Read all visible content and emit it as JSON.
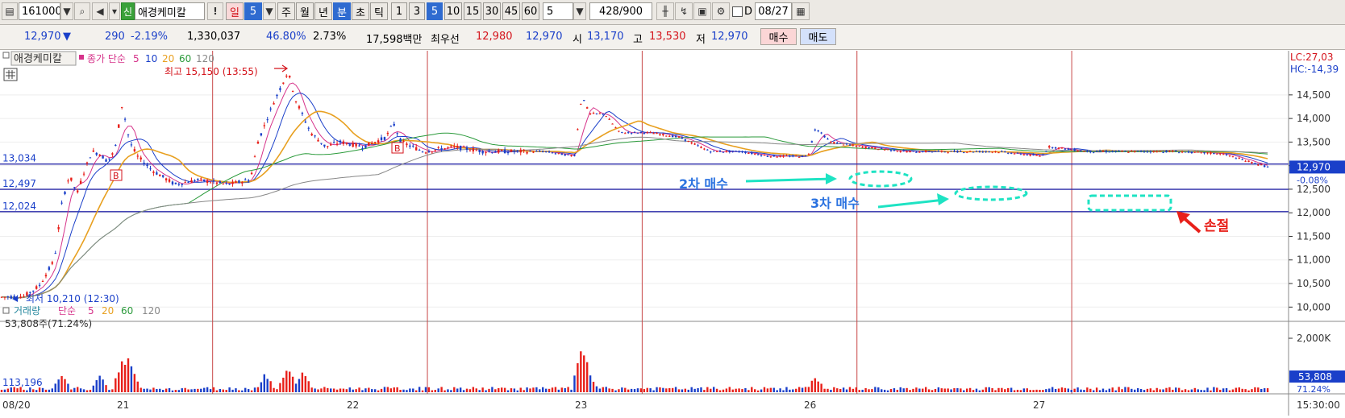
{
  "toolbar": {
    "code": "161000",
    "badge": "신",
    "stock_name": "애경케미칼",
    "exclaim": "!",
    "period_day": "일",
    "period_num": "5",
    "week": "주",
    "month": "월",
    "year": "년",
    "minute": "분",
    "second": "초",
    "tick": "틱",
    "intervals": [
      "1",
      "3",
      "5",
      "10",
      "15",
      "30",
      "45",
      "60"
    ],
    "selected_interval": "5",
    "count_value": "5",
    "bars_shown": "428",
    "bars_total": "/900",
    "date_check_label": "D",
    "date_value": "08/27"
  },
  "quote": {
    "price": "12,970",
    "change_arrow": "▼",
    "change": "290",
    "change_pct": "-2.19%",
    "volume": "1,330,037",
    "vol_ratio": "46.80%",
    "turnover": "2.73%",
    "amount": "17,598백만",
    "best_label": "최우선",
    "best_ask": "12,980",
    "best_bid": "12,970",
    "open_label": "시",
    "open": "13,170",
    "high_label": "고",
    "high": "13,530",
    "low_label": "저",
    "low": "12,970",
    "buy_button": "매수",
    "sell_button": "매도"
  },
  "price_panel": {
    "title": "애경케미칼",
    "ma_label": "종가 단순",
    "ma_periods": [
      "5",
      "10",
      "20",
      "60",
      "120"
    ],
    "ma_colors": [
      "#d6338a",
      "#1a3fc9",
      "#e8a020",
      "#2a9a3a",
      "#888888"
    ],
    "max_label": "최고 15,150 (13:55)",
    "min_label": "최저 10,210 (12:30)",
    "lc_label": "LC:27,03",
    "hc_label": "HC:-14,39",
    "y_ticks": [
      "14,500",
      "14,000",
      "13,500",
      "13,000",
      "12,500",
      "12,000",
      "11,500",
      "11,000",
      "10,500",
      "10,000"
    ],
    "current_price_tag": "12,970",
    "current_pct_tag": "-0.08%",
    "hlines": [
      "13,034",
      "12,497",
      "12,024"
    ],
    "annotation_2nd": "2차 매수",
    "annotation_3rd": "3차 매수",
    "annotation_stop": "손절"
  },
  "volume_panel": {
    "title": "거래량",
    "ma_label": "단순",
    "ma_periods": [
      "5",
      "20",
      "60",
      "120"
    ],
    "volume_info": "53,808주(71.24%)",
    "left_value": "113,196",
    "y_tick": "2,000K",
    "current_tag": "53,808",
    "current_pct": "71.24%"
  },
  "x_axis": {
    "labels": [
      "08/20",
      "21",
      "22",
      "23",
      "26",
      "27"
    ],
    "time_label": "15:30:00"
  },
  "chart_data": {
    "type": "candlestick",
    "unit": "KRW",
    "interval": "5min",
    "days": [
      "08/20",
      "08/21",
      "08/22",
      "08/23",
      "08/26",
      "08/27"
    ],
    "ylim": [
      9800,
      15300
    ],
    "price_path": [
      {
        "t": 0,
        "p": 10210
      },
      {
        "t": 3,
        "p": 10230
      },
      {
        "t": 5,
        "p": 10450
      },
      {
        "t": 7,
        "p": 11000
      },
      {
        "t": 8,
        "p": 12200
      },
      {
        "t": 9,
        "p": 12800
      },
      {
        "t": 10,
        "p": 12400
      },
      {
        "t": 11,
        "p": 12900
      },
      {
        "t": 12,
        "p": 13300
      },
      {
        "t": 13,
        "p": 13250
      },
      {
        "t": 14,
        "p": 13100
      },
      {
        "t": 15,
        "p": 13300
      },
      {
        "t": 16,
        "p": 14300
      },
      {
        "t": 17,
        "p": 13500
      },
      {
        "t": 18,
        "p": 13200
      },
      {
        "t": 20,
        "p": 12900
      },
      {
        "t": 23,
        "p": 12600
      },
      {
        "t": 26,
        "p": 12700
      },
      {
        "t": 30,
        "p": 12600
      },
      {
        "t": 33,
        "p": 12700
      },
      {
        "t": 34,
        "p": 13500
      },
      {
        "t": 36,
        "p": 14300
      },
      {
        "t": 38,
        "p": 15000
      },
      {
        "t": 39,
        "p": 14400
      },
      {
        "t": 41,
        "p": 13700
      },
      {
        "t": 43,
        "p": 13400
      },
      {
        "t": 45,
        "p": 13500
      },
      {
        "t": 48,
        "p": 13400
      },
      {
        "t": 51,
        "p": 13600
      },
      {
        "t": 52,
        "p": 13900
      },
      {
        "t": 53,
        "p": 13500
      },
      {
        "t": 56,
        "p": 13300
      },
      {
        "t": 60,
        "p": 13400
      },
      {
        "t": 64,
        "p": 13300
      },
      {
        "t": 68,
        "p": 13300
      },
      {
        "t": 72,
        "p": 13300
      },
      {
        "t": 76,
        "p": 13200
      },
      {
        "t": 77,
        "p": 14500
      },
      {
        "t": 78,
        "p": 14100
      },
      {
        "t": 80,
        "p": 14100
      },
      {
        "t": 82,
        "p": 13700
      },
      {
        "t": 86,
        "p": 13700
      },
      {
        "t": 90,
        "p": 13600
      },
      {
        "t": 94,
        "p": 13300
      },
      {
        "t": 98,
        "p": 13300
      },
      {
        "t": 102,
        "p": 13200
      },
      {
        "t": 107,
        "p": 13200
      },
      {
        "t": 108,
        "p": 13800
      },
      {
        "t": 110,
        "p": 13500
      },
      {
        "t": 114,
        "p": 13400
      },
      {
        "t": 120,
        "p": 13300
      },
      {
        "t": 126,
        "p": 13300
      },
      {
        "t": 132,
        "p": 13300
      },
      {
        "t": 138,
        "p": 13200
      },
      {
        "t": 139,
        "p": 13400
      },
      {
        "t": 144,
        "p": 13300
      },
      {
        "t": 150,
        "p": 13300
      },
      {
        "t": 156,
        "p": 13300
      },
      {
        "t": 162,
        "p": 13250
      },
      {
        "t": 168,
        "p": 12970
      }
    ],
    "moving_averages": [
      {
        "name": "5",
        "color": "#d6338a"
      },
      {
        "name": "10",
        "color": "#1a3fc9"
      },
      {
        "name": "20",
        "color": "#e8a020"
      },
      {
        "name": "60",
        "color": "#2a9a3a"
      },
      {
        "name": "120",
        "color": "#888888"
      }
    ],
    "horizontal_lines": [
      13034,
      12497,
      12024
    ],
    "volume_spikes": [
      {
        "t": 8,
        "v": 0.38
      },
      {
        "t": 13,
        "v": 0.33
      },
      {
        "t": 16,
        "v": 0.65
      },
      {
        "t": 17,
        "v": 0.72
      },
      {
        "t": 35,
        "v": 0.35
      },
      {
        "t": 38,
        "v": 0.55
      },
      {
        "t": 40,
        "v": 0.45
      },
      {
        "t": 77,
        "v": 0.95
      },
      {
        "t": 78,
        "v": 0.35
      },
      {
        "t": 108,
        "v": 0.3
      }
    ]
  }
}
